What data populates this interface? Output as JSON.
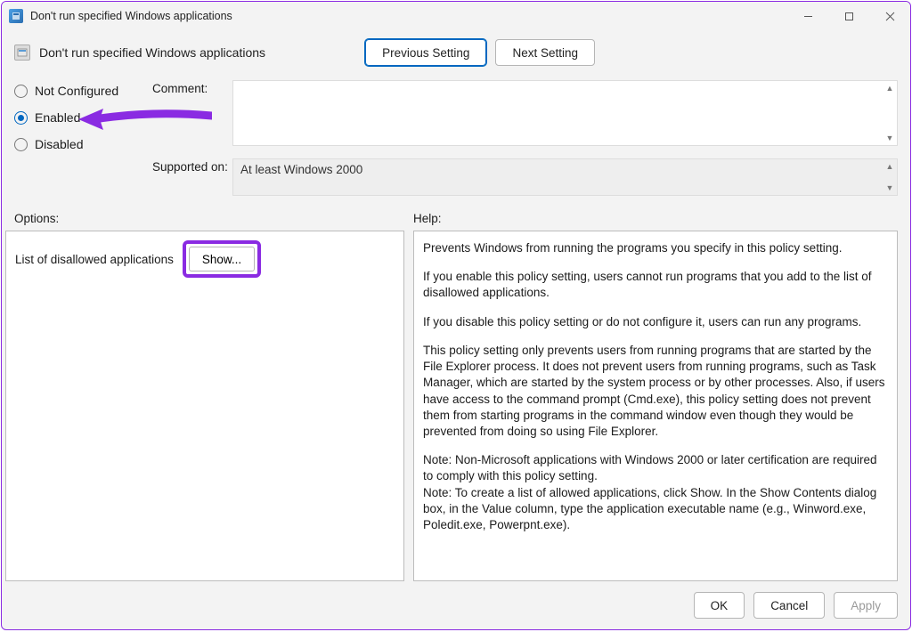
{
  "window": {
    "title": "Don't run specified Windows applications"
  },
  "header": {
    "policy_title": "Don't run specified Windows applications",
    "prev": "Previous Setting",
    "next": "Next Setting"
  },
  "state": {
    "not_configured": "Not Configured",
    "enabled": "Enabled",
    "disabled": "Disabled",
    "comment_label": "Comment:",
    "supported_label": "Supported on:",
    "supported_value": "At least Windows 2000"
  },
  "panes": {
    "options_hdr": "Options:",
    "help_hdr": "Help:",
    "option_label": "List of disallowed applications",
    "show_btn": "Show..."
  },
  "help": {
    "p1": "Prevents Windows from running the programs you specify in this policy setting.",
    "p2": "If you enable this policy setting, users cannot run programs that you add to the list of disallowed applications.",
    "p3": "If you disable this policy setting or do not configure it, users can run any programs.",
    "p4": "This policy setting only prevents users from running programs that are started by the File Explorer process. It does not prevent users from running programs, such as Task Manager, which are started by the system process or by other processes.  Also, if users have access to the command prompt (Cmd.exe), this policy setting does not prevent them from starting programs in the command window even though they would be prevented from doing so using File Explorer.",
    "p5": "Note: Non-Microsoft applications with Windows 2000 or later certification are required to comply with this policy setting.",
    "p6": "Note: To create a list of allowed applications, click Show.  In the Show Contents dialog box, in the Value column, type the application executable name (e.g., Winword.exe, Poledit.exe, Powerpnt.exe)."
  },
  "footer": {
    "ok": "OK",
    "cancel": "Cancel",
    "apply": "Apply"
  }
}
